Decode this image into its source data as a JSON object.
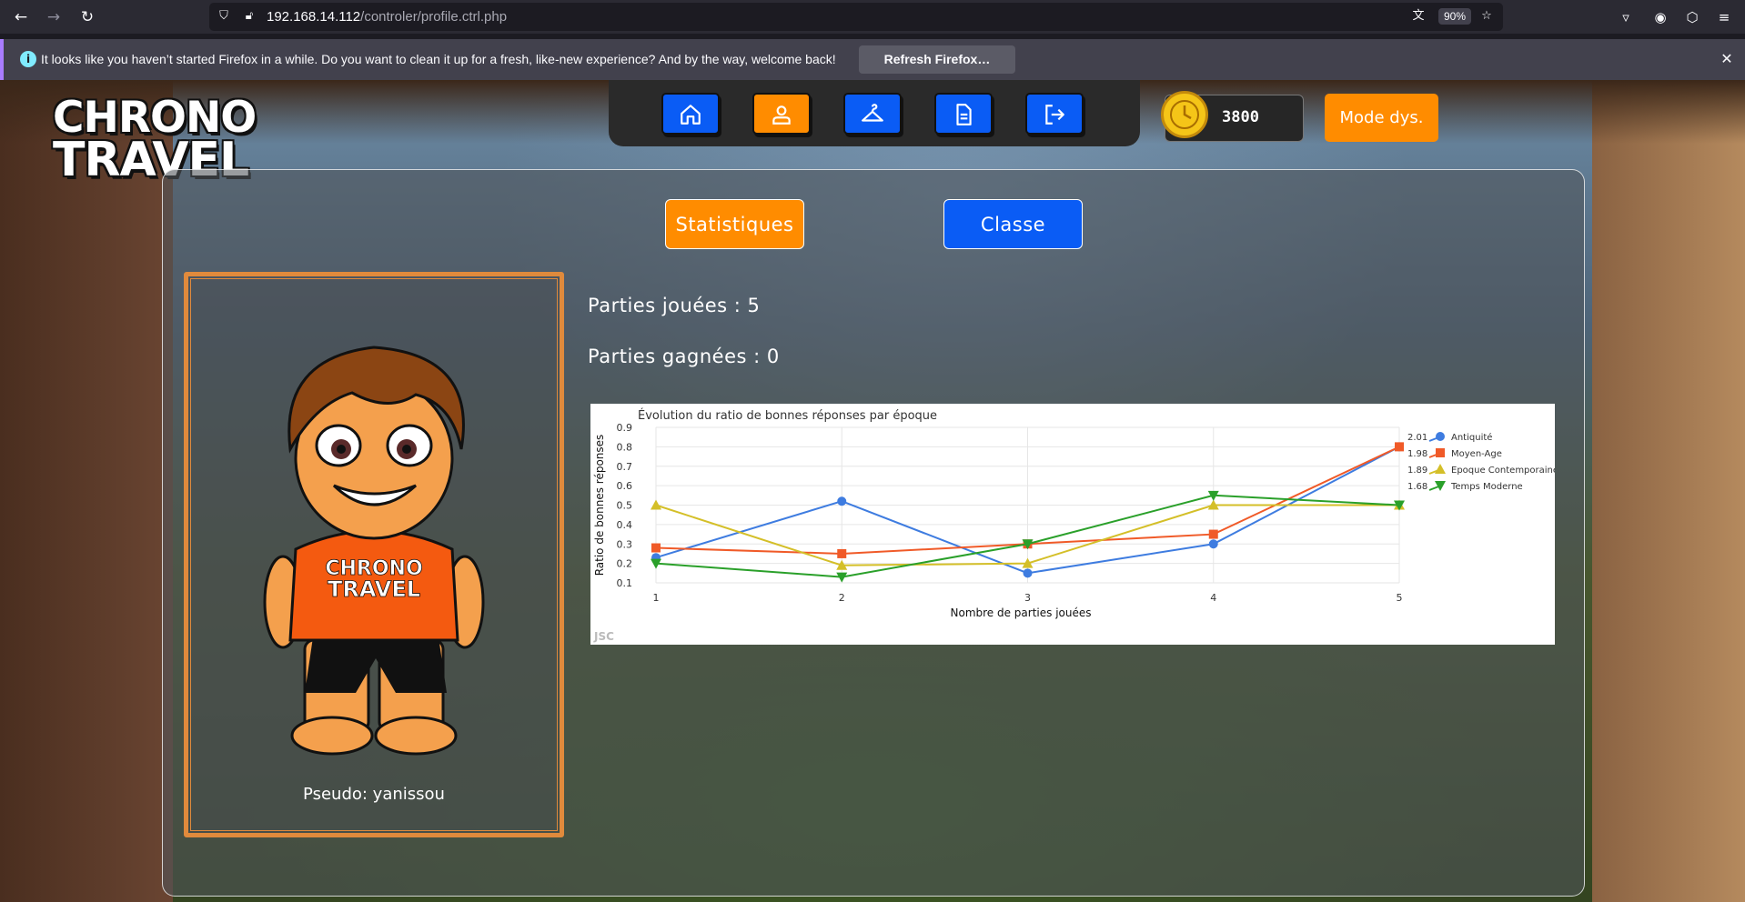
{
  "browser": {
    "url_host": "192.168.14.112",
    "url_path": "/controler/profile.ctrl.php",
    "zoom": "90%",
    "notification_text": "It looks like you haven’t started Firefox in a while. Do you want to clean it up for a fresh, like-new experience? And by the way, welcome back!",
    "notification_button": "Refresh Firefox…"
  },
  "app": {
    "logo_line1": "CHRONO",
    "logo_line2": "TRAVEL",
    "coins": "3800",
    "mode_button": "Mode dys.",
    "nav_icons": [
      "home-icon",
      "user-icon",
      "hanger-icon",
      "document-icon",
      "logout-icon"
    ],
    "tabs": {
      "stats": "Statistiques",
      "class": "Classe"
    },
    "pseudo": "Pseudo: yanissou",
    "played": "Parties jouées : 5",
    "won": "Parties gagnées : 0",
    "shirt_text_1": "CHRONO",
    "shirt_text_2": "TRAVEL"
  },
  "colors": {
    "orange": "#ff8c00",
    "blue": "#0a5cf5",
    "frame": "#e08a3c"
  },
  "chart_data": {
    "type": "line",
    "title": "Évolution du ratio de bonnes réponses par époque",
    "xlabel": "Nombre de parties jouées",
    "ylabel": "Ratio de bonnes réponses",
    "x": [
      1,
      2,
      3,
      4,
      5
    ],
    "ylim": [
      0.1,
      0.9
    ],
    "yticks": [
      "0.1",
      "0.2",
      "0.3",
      "0.4",
      "0.5",
      "0.6",
      "0.7",
      "0.8",
      "0.9"
    ],
    "xticks": [
      "1",
      "2",
      "3",
      "4",
      "5"
    ],
    "grid": true,
    "legend_position": "right",
    "watermark": "JSC",
    "series": [
      {
        "name": "Antiquité",
        "total": "2.01",
        "color": "#3e7ce0",
        "marker": "circle",
        "values": [
          0.23,
          0.52,
          0.15,
          0.3,
          0.8
        ]
      },
      {
        "name": "Moyen-Age",
        "total": "1.98",
        "color": "#f05a28",
        "marker": "square",
        "values": [
          0.28,
          0.25,
          0.3,
          0.35,
          0.8
        ]
      },
      {
        "name": "Epoque Contemporaine",
        "total": "1.89",
        "color": "#d4bf28",
        "marker": "triangle-up",
        "values": [
          0.5,
          0.19,
          0.2,
          0.5,
          0.5
        ]
      },
      {
        "name": "Temps Moderne",
        "total": "1.68",
        "color": "#2aa02a",
        "marker": "triangle-down",
        "values": [
          0.2,
          0.13,
          0.3,
          0.55,
          0.5
        ]
      }
    ]
  }
}
